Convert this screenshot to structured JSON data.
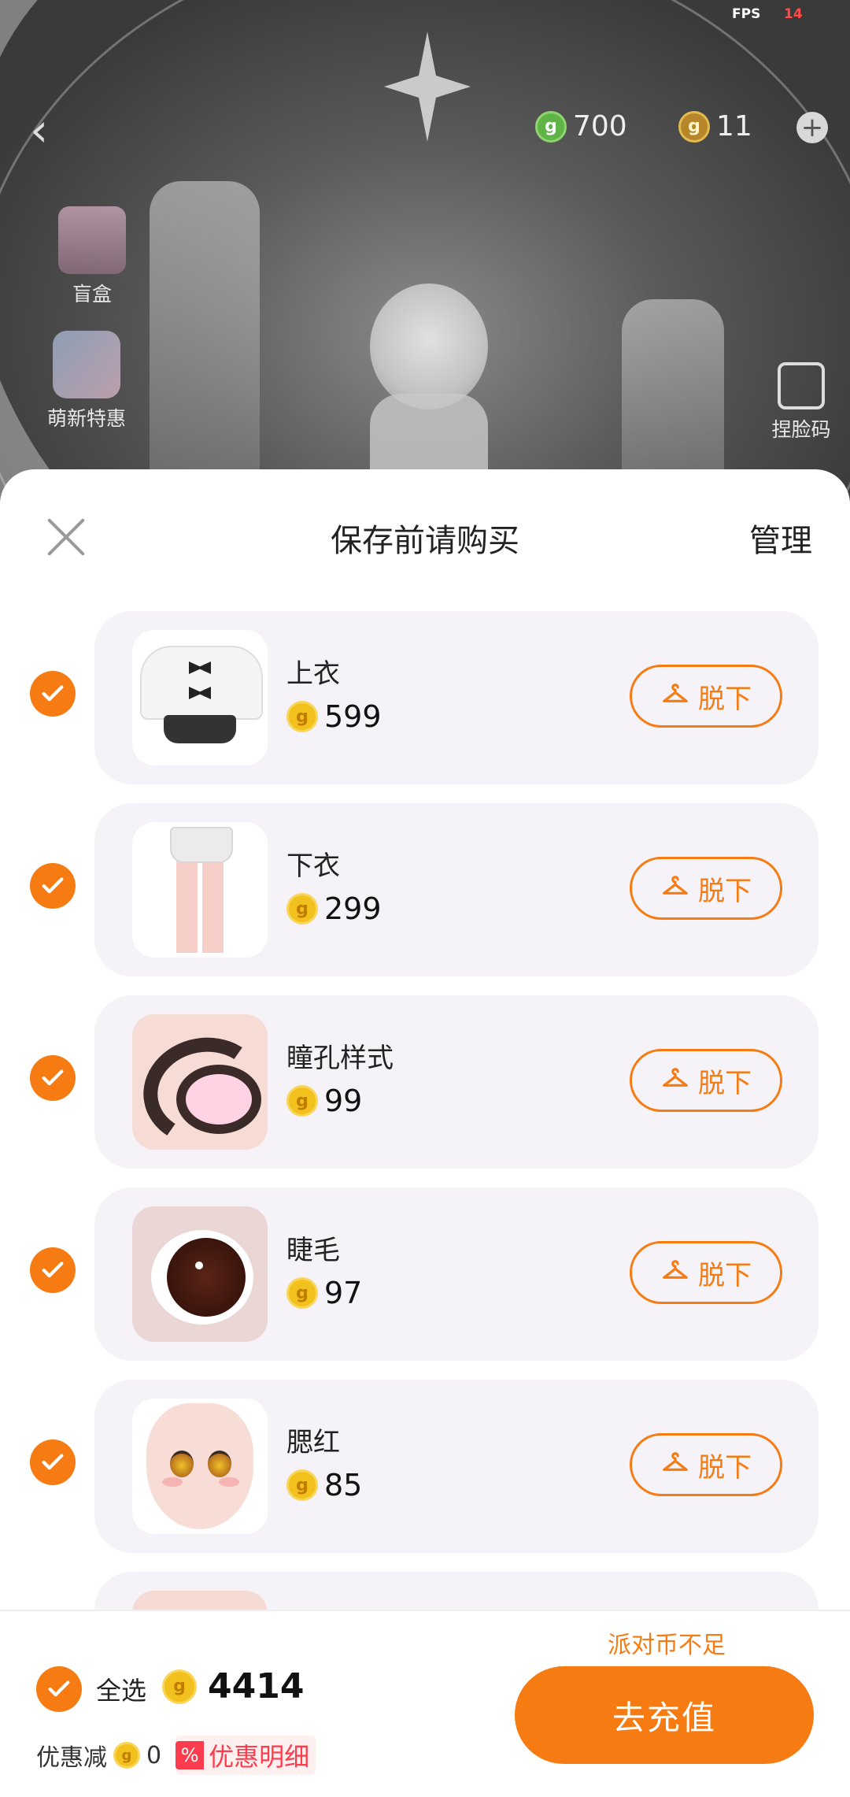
{
  "status": {
    "fps_label": "FPS",
    "fps_value": "14"
  },
  "top_bar": {
    "green_coin_icon": "g",
    "green_coin_amount": "700",
    "gold_coin_icon": "g",
    "gold_coin_amount": "11"
  },
  "side_menu": {
    "blind_box_label": "盲盒",
    "newbie_deal_label": "萌新特惠",
    "face_code_label": "捏脸码"
  },
  "sheet": {
    "title": "保存前请购买",
    "manage_label": "管理",
    "take_off_label": "脱下",
    "coin_glyph": "g",
    "items": [
      {
        "name": "上衣",
        "price": "599"
      },
      {
        "name": "下衣",
        "price": "299"
      },
      {
        "name": "瞳孔样式",
        "price": "99"
      },
      {
        "name": "睫毛",
        "price": "97"
      },
      {
        "name": "腮红",
        "price": "85"
      }
    ]
  },
  "footer": {
    "select_all_label": "全选",
    "total_amount": "4414",
    "discount_label": "优惠减",
    "discount_amount": "0",
    "discount_detail_label": "优惠明细",
    "percent_glyph": "%",
    "insufficient_notice": "派对币不足",
    "recharge_label": "去充值"
  },
  "colors": {
    "accent": "#F57B12",
    "card_bg": "#F5F3F8",
    "coin_gold": "#F3C11D",
    "discount_red": "#FF3C4E"
  }
}
